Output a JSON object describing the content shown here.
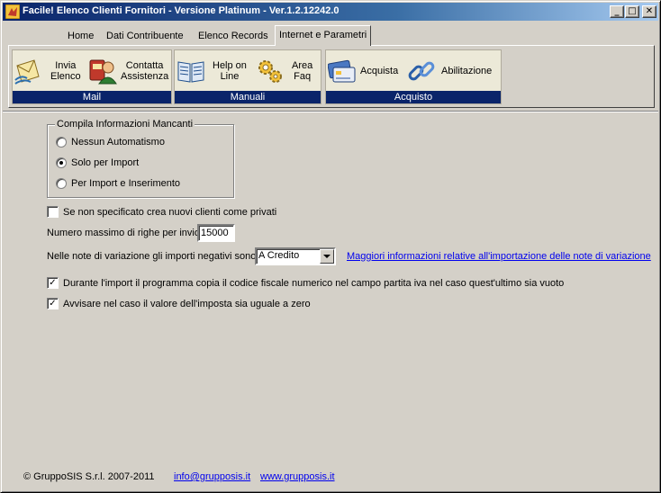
{
  "window": {
    "title": "Facile! Elenco Clienti Fornitori - Versione Platinum - Ver.1.2.12242.0",
    "minimize": "_",
    "maximize": "□",
    "close": "✕"
  },
  "tabs": [
    {
      "label": "Home"
    },
    {
      "label": "Dati Contribuente"
    },
    {
      "label": "Elenco Records"
    },
    {
      "label": "Internet e Parametri"
    }
  ],
  "ribbon": {
    "groups": [
      {
        "label": "Mail",
        "buttons": [
          {
            "label": "Invia\nElenco",
            "icon": "mail-send-icon"
          },
          {
            "label": "Contatta\nAssistenza",
            "icon": "support-contact-icon"
          }
        ]
      },
      {
        "label": "Manuali",
        "buttons": [
          {
            "label": "Help on\nLine",
            "icon": "book-icon"
          },
          {
            "label": "Area\nFaq",
            "icon": "gears-icon"
          }
        ]
      },
      {
        "label": "Acquisto",
        "buttons": [
          {
            "label": "Acquista",
            "icon": "credit-card-icon"
          },
          {
            "label": "Abilitazione",
            "icon": "chain-link-icon"
          }
        ]
      }
    ]
  },
  "settings": {
    "group_title": "Compila Informazioni Mancanti",
    "radios": [
      {
        "label": "Nessun Automatismo",
        "checked": false
      },
      {
        "label": "Solo per Import",
        "checked": true
      },
      {
        "label": "Per Import e Inserimento",
        "checked": false
      }
    ],
    "private_checkbox": {
      "label": "Se non specificato crea nuovi clienti come privati",
      "checked": false
    },
    "max_rows_label": "Numero massimo di righe per invio:",
    "max_rows_value": "15000",
    "negative_label": "Nelle note di variazione gli importi negativi sono:",
    "negative_value": "A Credito",
    "more_info_link": "Maggiori informazioni relative all'importazione delle note di variazione",
    "copy_cf_checkbox": {
      "label": "Durante l'import il programma copia il codice fiscale numerico nel campo partita iva nel  caso quest'ultimo sia vuoto",
      "checked": true
    },
    "warn_zero_checkbox": {
      "label": "Avvisare nel caso il valore dell'imposta sia uguale a zero",
      "checked": true
    },
    "check_mark": "✓"
  },
  "footer": {
    "copyright": "© GruppoSIS S.r.l. 2007-2011",
    "email": "info@grupposis.it",
    "website": "www.grupposis.it"
  },
  "colors": {
    "title_bar": "#0a246a",
    "group_label_bg": "#0a246a",
    "link": "#0000ee",
    "window_bg": "#d4d0c8"
  }
}
